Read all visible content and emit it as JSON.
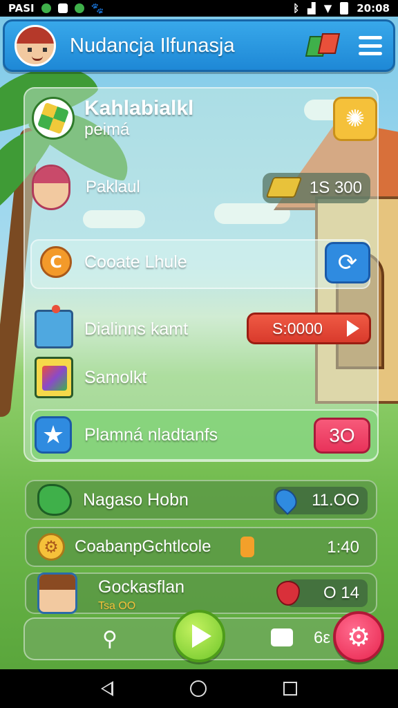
{
  "status_bar": {
    "carrier": "PASI",
    "time": "20:08"
  },
  "header": {
    "title": "Nudancja Ilfunasja"
  },
  "panel": {
    "title": "Kahlabialkl",
    "subtitle": "peimá",
    "player_name": "Paklaul",
    "coin_value": "1S 300",
    "item_1": "Cooate Lhule",
    "item_2": "Dialinns kamt",
    "item_2_price": "S:0000",
    "item_3": "Samolkt",
    "highlight_label": "Plamná nladtanfs",
    "highlight_value": "3O"
  },
  "list": [
    {
      "label": "Nagaso Hobn",
      "value": "11.OO"
    },
    {
      "label": "CoabanpGchtlcole",
      "value": "1:40"
    },
    {
      "label": "Gockasflan",
      "value": "O 14",
      "sub": "Tsa OO"
    }
  ],
  "toolbar": {
    "counter": "6ε"
  },
  "colors": {
    "header_blue": "#1e88d6",
    "play_green": "#6fc62a",
    "settings_red": "#e8254e",
    "price_red": "#d93a2c",
    "highlight_pink": "#e8325a"
  }
}
